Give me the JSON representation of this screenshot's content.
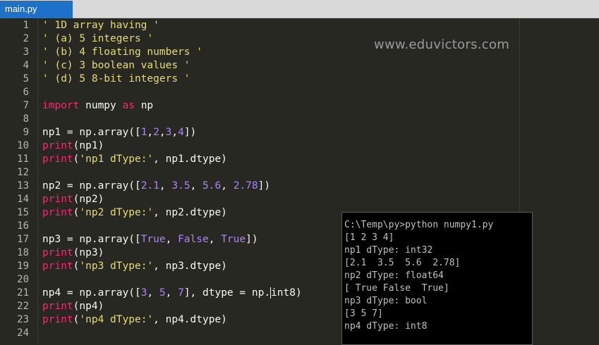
{
  "tab": {
    "label": "main.py"
  },
  "watermark": "www.eduvictors.com",
  "editor": {
    "line_numbers": [
      "1",
      "2",
      "3",
      "4",
      "5",
      "6",
      "7",
      "8",
      "9",
      "10",
      "11",
      "12",
      "13",
      "14",
      "15",
      "16",
      "17",
      "18",
      "19",
      "20",
      "21",
      "22",
      "23",
      "24"
    ],
    "lines": {
      "l1": "' 1D array having '",
      "l2": "' (a) 5 integers '",
      "l3": "' (b) 4 floating numbers '",
      "l4": "' (c) 3 boolean values '",
      "l5": "' (d) 5 8-bit integers '",
      "l7_kw1": "import",
      "l7_mid": " numpy ",
      "l7_kw2": "as",
      "l7_end": " np",
      "l9_a": "np1 = np.array([",
      "l9_n1": "1",
      "l9_n2": "2",
      "l9_n3": "3",
      "l9_n4": "4",
      "l9_b": "])",
      "l10_fn": "print",
      "l10_rest": "(np1)",
      "l11_fn": "print",
      "l11_str": "'np1 dType:'",
      "l11_rest": ", np1.dtype)",
      "l13_a": "np2 = np.array([",
      "l13_n1": "2.1",
      "l13_n2": "3.5",
      "l13_n3": "5.6",
      "l13_n4": "2.78",
      "l13_b": "])",
      "l14_fn": "print",
      "l14_rest": "(np2)",
      "l15_fn": "print",
      "l15_str": "'np2 dType:'",
      "l15_rest": ", np2.dtype)",
      "l17_a": "np3 = np.array([",
      "l17_c1": "True",
      "l17_c2": "False",
      "l17_c3": "True",
      "l17_b": "])",
      "l18_fn": "print",
      "l18_rest": "(np3)",
      "l19_fn": "print",
      "l19_str": "'np3 dType:'",
      "l19_rest": ", np3.dtype)",
      "l21_a": "np4 = np.array([",
      "l21_n1": "3",
      "l21_n2": "5",
      "l21_n3": "7",
      "l21_b": "], dtype = np.",
      "l21_c": "int8)",
      "l22_fn": "print",
      "l22_rest": "(np4)",
      "l23_fn": "print",
      "l23_str": "'np4 dType:'",
      "l23_rest": ", np4.dtype)"
    }
  },
  "console": {
    "lines": [
      "C:\\Temp\\py>python numpy1.py",
      "[1 2 3 4]",
      "np1 dType: int32",
      "[2.1  3.5  5.6  2.78]",
      "np2 dType: float64",
      "[ True False  True]",
      "np3 dType: bool",
      "[3 5 7]",
      "np4 dType: int8"
    ]
  },
  "colors": {
    "editor_bg": "#272822",
    "string": "#e6db74",
    "keyword": "#f92672",
    "number": "#ae81ff",
    "tab_active": "#1e71c9",
    "console_bg": "#000000",
    "console_text": "#c0c0c0"
  }
}
